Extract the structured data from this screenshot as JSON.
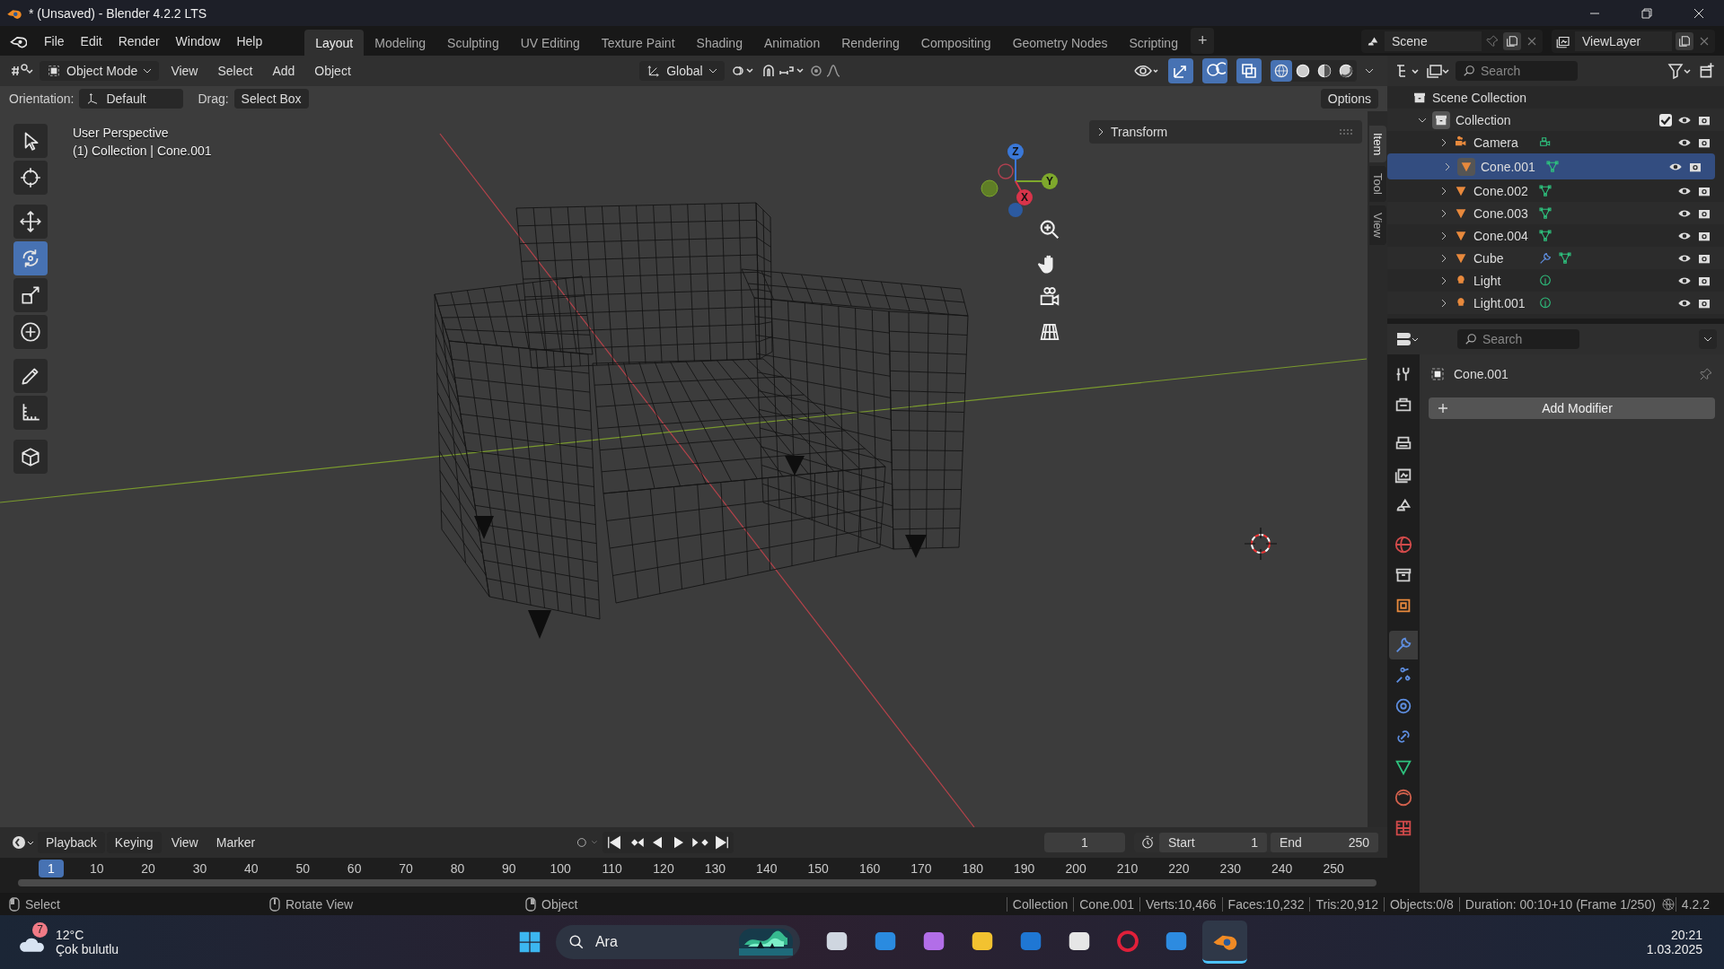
{
  "window": {
    "title": "* (Unsaved) - Blender 4.2.2 LTS"
  },
  "menu": [
    "File",
    "Edit",
    "Render",
    "Window",
    "Help"
  ],
  "workspaces": [
    {
      "label": "Layout",
      "selected": true
    },
    {
      "label": "Modeling",
      "selected": false
    },
    {
      "label": "Sculpting",
      "selected": false
    },
    {
      "label": "UV Editing",
      "selected": false
    },
    {
      "label": "Texture Paint",
      "selected": false
    },
    {
      "label": "Shading",
      "selected": false
    },
    {
      "label": "Animation",
      "selected": false
    },
    {
      "label": "Rendering",
      "selected": false
    },
    {
      "label": "Compositing",
      "selected": false
    },
    {
      "label": "Geometry Nodes",
      "selected": false
    },
    {
      "label": "Scripting",
      "selected": false
    }
  ],
  "add_workspace": "+",
  "scene": {
    "name": "Scene",
    "view_layer": "ViewLayer"
  },
  "viewport": {
    "mode": "Object Mode",
    "menus": [
      "View",
      "Select",
      "Add",
      "Object"
    ],
    "transform_orientation": "Global",
    "toggles": [
      {
        "kind": "gizmos",
        "on": true
      },
      {
        "kind": "overlays",
        "on": true
      },
      {
        "kind": "xray",
        "on": true
      }
    ],
    "shading": [
      {
        "kind": "wireframe",
        "selected": true
      },
      {
        "kind": "solid",
        "selected": false
      },
      {
        "kind": "material",
        "selected": false
      },
      {
        "kind": "rendered",
        "selected": false
      }
    ],
    "orientation_label": "Orientation:",
    "orientation": "Default",
    "drag_label": "Drag:",
    "drag": "Select Box",
    "options": "Options",
    "view_name": "User Perspective",
    "context": "(1) Collection | Cone.001",
    "tools": [
      {
        "kind": "select",
        "selected": false
      },
      {
        "kind": "cursor",
        "selected": false
      },
      {
        "kind": "move",
        "selected": false
      },
      {
        "kind": "rotate",
        "selected": true
      },
      {
        "kind": "scale",
        "selected": false
      },
      {
        "kind": "transform",
        "selected": false
      },
      {
        "kind": "annotate",
        "selected": false
      },
      {
        "kind": "measure",
        "selected": false
      },
      {
        "kind": "add_cube",
        "selected": false
      }
    ],
    "gizmo_axes": [
      "Z",
      "Y",
      "X"
    ],
    "sidebar": {
      "panel": "Transform",
      "tabs": [
        {
          "label": "Item",
          "selected": true
        },
        {
          "label": "Tool",
          "selected": false
        },
        {
          "label": "View",
          "selected": false
        }
      ]
    }
  },
  "outliner": {
    "search_placeholder": "Search",
    "root": "Scene Collection",
    "collection": {
      "name": "Collection",
      "expanded": true,
      "checked": true,
      "children": [
        {
          "name": "Camera",
          "kind": "camera",
          "selected": false,
          "modifier": false
        },
        {
          "name": "Cone.001",
          "kind": "mesh",
          "selected": true,
          "modifier": false
        },
        {
          "name": "Cone.002",
          "kind": "mesh",
          "selected": false,
          "modifier": false
        },
        {
          "name": "Cone.003",
          "kind": "mesh",
          "selected": false,
          "modifier": false
        },
        {
          "name": "Cone.004",
          "kind": "mesh",
          "selected": false,
          "modifier": false
        },
        {
          "name": "Cube",
          "kind": "mesh",
          "selected": false,
          "modifier": true
        },
        {
          "name": "Light",
          "kind": "light",
          "selected": false,
          "modifier": false
        },
        {
          "name": "Light.001",
          "kind": "light",
          "selected": false,
          "modifier": false
        }
      ]
    }
  },
  "properties": {
    "search_placeholder": "Search",
    "object": "Cone.001",
    "add_modifier": "Add Modifier",
    "tabs": [
      {
        "kind": "tool",
        "selected": false
      },
      {
        "kind": "render",
        "selected": false
      },
      {
        "kind": "output",
        "selected": false
      },
      {
        "kind": "view_layer",
        "selected": false
      },
      {
        "kind": "scene",
        "selected": false
      },
      {
        "kind": "world",
        "selected": false
      },
      {
        "kind": "collection",
        "selected": false
      },
      {
        "kind": "object",
        "selected": false
      },
      {
        "kind": "modifiers",
        "selected": true
      },
      {
        "kind": "particles",
        "selected": false
      },
      {
        "kind": "physics",
        "selected": false
      },
      {
        "kind": "constraints",
        "selected": false
      },
      {
        "kind": "data",
        "selected": false
      },
      {
        "kind": "material",
        "selected": false
      },
      {
        "kind": "texture",
        "selected": false
      }
    ]
  },
  "timeline": {
    "menus": [
      "Playback",
      "Keying",
      "View",
      "Marker"
    ],
    "current_frame": "1",
    "start_label": "Start",
    "start": "1",
    "end_label": "End",
    "end": "250",
    "ruler": [
      {
        "label": "1",
        "selected": true
      },
      {
        "label": "10",
        "selected": false
      },
      {
        "label": "20",
        "selected": false
      },
      {
        "label": "30",
        "selected": false
      },
      {
        "label": "40",
        "selected": false
      },
      {
        "label": "50",
        "selected": false
      },
      {
        "label": "60",
        "selected": false
      },
      {
        "label": "70",
        "selected": false
      },
      {
        "label": "80",
        "selected": false
      },
      {
        "label": "90",
        "selected": false
      },
      {
        "label": "100",
        "selected": false
      },
      {
        "label": "110",
        "selected": false
      },
      {
        "label": "120",
        "selected": false
      },
      {
        "label": "130",
        "selected": false
      },
      {
        "label": "140",
        "selected": false
      },
      {
        "label": "150",
        "selected": false
      },
      {
        "label": "160",
        "selected": false
      },
      {
        "label": "170",
        "selected": false
      },
      {
        "label": "180",
        "selected": false
      },
      {
        "label": "190",
        "selected": false
      },
      {
        "label": "200",
        "selected": false
      },
      {
        "label": "210",
        "selected": false
      },
      {
        "label": "220",
        "selected": false
      },
      {
        "label": "230",
        "selected": false
      },
      {
        "label": "240",
        "selected": false
      },
      {
        "label": "250",
        "selected": false
      }
    ]
  },
  "status_bar": {
    "hints": [
      "Select",
      "Rotate View",
      "Object"
    ],
    "stats": [
      "Collection",
      "Cone.001",
      "Verts:10,466",
      "Faces:10,232",
      "Tris:20,912",
      "Objects:0/8",
      "Duration: 00:10+10 (Frame 1/250)"
    ],
    "version": "4.2.2"
  },
  "taskbar": {
    "weather": {
      "badge": "7",
      "temperature": "12°C",
      "condition": "Çok bulutlu"
    },
    "search_placeholder": "Ara",
    "apps": [
      {
        "kind": "task_view",
        "selected": false
      },
      {
        "kind": "edge",
        "selected": false
      },
      {
        "kind": "copilot",
        "selected": false
      },
      {
        "kind": "explorer",
        "selected": false
      },
      {
        "kind": "outlook",
        "selected": false
      },
      {
        "kind": "store",
        "selected": false
      },
      {
        "kind": "opera",
        "selected": false
      },
      {
        "kind": "widgets",
        "selected": false
      },
      {
        "kind": "blender",
        "selected": true
      }
    ],
    "time": "20:21",
    "date": "1.03.2025"
  }
}
